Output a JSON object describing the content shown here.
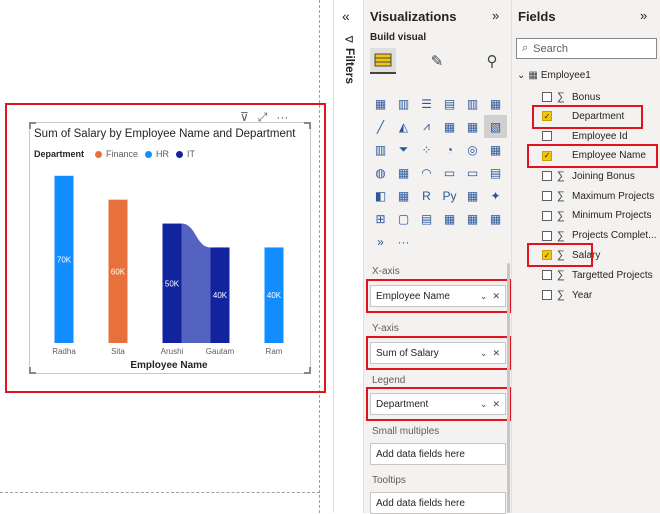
{
  "canvas": {
    "visual": {
      "title": "Sum of Salary by Employee Name and Department",
      "legend_title": "Department",
      "toolbar_icons": [
        "filter-icon",
        "focus-mode-icon",
        "more-options-icon"
      ]
    }
  },
  "chart_data": {
    "type": "bar",
    "title": "Sum of Salary by Employee Name and Department",
    "xlabel": "Employee Name",
    "ylabel": "",
    "categories": [
      "Radha",
      "Sita",
      "Arushi",
      "Gautam",
      "Ram"
    ],
    "legend": [
      "Finance",
      "HR",
      "IT"
    ],
    "series_colors": {
      "Finance": "#e8703a",
      "HR": "#118dff",
      "IT": "#12239e"
    },
    "bars": [
      {
        "category": "Radha",
        "department": "HR",
        "value": 70000,
        "label": "70K"
      },
      {
        "category": "Sita",
        "department": "Finance",
        "value": 60000,
        "label": "60K"
      },
      {
        "category": "Arushi",
        "department": "IT",
        "value": 50000,
        "label": "50K"
      },
      {
        "category": "Gautam",
        "department": "IT",
        "value": 40000,
        "label": "40K"
      },
      {
        "category": "Ram",
        "department": "HR",
        "value": 40000,
        "label": "40K"
      }
    ],
    "ylim": [
      0,
      72000
    ],
    "ribbon_between": [
      "Arushi",
      "Gautam"
    ]
  },
  "filters": {
    "label": "Filters",
    "collapse_icon": "«"
  },
  "visualizations": {
    "title": "Visualizations",
    "expand_icon": "»",
    "build_visual": "Build visual",
    "more": "···",
    "x_axis_label": "X-axis",
    "x_axis_field": "Employee Name",
    "y_axis_label": "Y-axis",
    "y_axis_field": "Sum of Salary",
    "legend_label": "Legend",
    "legend_field": "Department",
    "small_multiples_label": "Small multiples",
    "small_multiples_placeholder": "Add data fields here",
    "tooltips_label": "Tooltips",
    "tooltips_placeholder": "Add data fields here",
    "grid_icons": [
      "▦",
      "▥",
      "☰",
      "▤",
      "▥",
      "▦",
      "╱",
      "◭",
      "⩘",
      "▦",
      "▦",
      "▧",
      "▥",
      "⏷",
      "⁘",
      "◔",
      "◎",
      "▦",
      "◍",
      "▦",
      "◠",
      "▭",
      "▭",
      "▤",
      "◧",
      "▦",
      "R",
      "Py",
      "▦",
      "✦",
      "⊞",
      "▢",
      "▤",
      "▦",
      "▦",
      "▦",
      "»"
    ]
  },
  "fields": {
    "title": "Fields",
    "expand_icon": "»",
    "search_placeholder": "Search",
    "table_name": "Employee1",
    "items": [
      {
        "name": "Bonus",
        "checked": false,
        "sigma": true
      },
      {
        "name": "Department",
        "checked": true,
        "sigma": false
      },
      {
        "name": "Employee Id",
        "checked": false,
        "sigma": false
      },
      {
        "name": "Employee Name",
        "checked": true,
        "sigma": false
      },
      {
        "name": "Joining Bonus",
        "checked": false,
        "sigma": true
      },
      {
        "name": "Maximum Projects",
        "checked": false,
        "sigma": true
      },
      {
        "name": "Minimum Projects",
        "checked": false,
        "sigma": true
      },
      {
        "name": "Projects Complet...",
        "checked": false,
        "sigma": true
      },
      {
        "name": "Salary",
        "checked": true,
        "sigma": true
      },
      {
        "name": "Targetted Projects",
        "checked": false,
        "sigma": true
      },
      {
        "name": "Year",
        "checked": false,
        "sigma": true
      }
    ]
  }
}
